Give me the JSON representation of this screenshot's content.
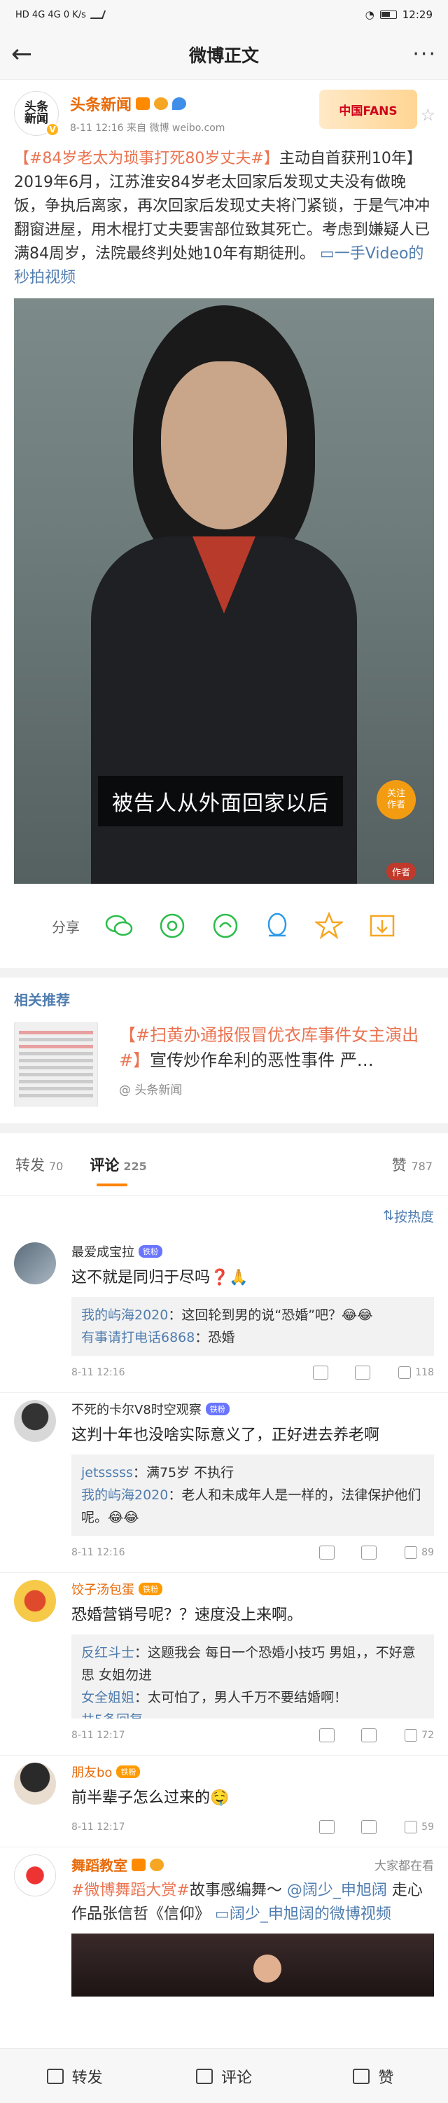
{
  "status": {
    "left": "HD 4G 4G 0 K/s",
    "time": "12:29"
  },
  "nav": {
    "title": "微博正文"
  },
  "author": {
    "name": "头条新闻",
    "avatar_text": "头条\n新闻",
    "meta": "8-11 12:16  来自 微博 weibo.com",
    "fans_badge": "中国FANS"
  },
  "post": {
    "topic": "【#84岁老太为琐事打死80岁丈夫#】",
    "body": "主动自首获刑10年】2019年6月，江苏淮安84岁老太回家后发现丈夫没有做晚饭，争执后离家，再次回家后发现丈夫将门紧锁，于是气冲冲翻窗进屋，用木棍打丈夫要害部位致其死亡。考虑到嫌疑人已满84周岁，法院最终判处她10年有期徒刑。",
    "link": "一手Video的秒拍视频"
  },
  "video": {
    "subtitle": "被告人从外面回家以后",
    "follow": "关注\n作者",
    "author_tag": "作者"
  },
  "share": {
    "label": "分享"
  },
  "recommend": {
    "title": "相关推荐",
    "topic": "【#扫黄办通报假冒优衣库事件女主演出#】",
    "text": "宣传炒作牟利的恶性事件 严…",
    "source": "@ 头条新闻"
  },
  "tabs": {
    "repost": "转发",
    "repost_count": "70",
    "comment": "评论",
    "comment_count": "225",
    "like": "赞",
    "like_count": "787",
    "sort": "按热度"
  },
  "comments": [
    {
      "name": "最爱成宝拉",
      "pill": "铁粉",
      "text": "这不就是同归于尽吗❓🙏",
      "replies": [
        {
          "name": "我的屿海2020",
          "text": "这回轮到男的说“恐婚”吧？😂😂"
        },
        {
          "name": "有事请打电话6868",
          "text": "恐婚"
        }
      ],
      "time": "8-11 12:16",
      "likes": "118"
    },
    {
      "name": "不死的卡尔V8时空观察",
      "pill": "铁粉",
      "text": "这判十年也没啥实际意义了，正好进去养老啊",
      "replies": [
        {
          "name": "jetsssss",
          "text": "满75岁 不执行"
        },
        {
          "name": "我的屿海2020",
          "text": "老人和未成年人是一样的，法律保护他们呢。😂😂"
        }
      ],
      "time": "8-11 12:16",
      "likes": "89"
    },
    {
      "name": "饺子汤包蛋",
      "pill": "铁粉",
      "text": "恐婚营销号呢？？速度没上来啊。",
      "replies": [
        {
          "name": "反红斗士",
          "text": "这题我会 每日一个恐婚小技巧 男姐，，不好意思 女姐勿进"
        },
        {
          "name": "女全姐姐",
          "text": "太可怕了，男人千万不要结婚啊！"
        },
        {
          "name": "共5条回复",
          "text": ""
        }
      ],
      "time": "8-11 12:17",
      "likes": "72"
    },
    {
      "name": "朋友bo",
      "pill": "铁粉",
      "text": "前半辈子怎么过来的🤤",
      "replies": [],
      "time": "8-11 12:17",
      "likes": "59"
    }
  ],
  "bottom_post": {
    "name": "舞蹈教室",
    "tag": "大家都在看",
    "topic": "#微博舞蹈大赏#",
    "text": "故事感编舞～",
    "mention": "@阔少_申旭阔",
    "text2": "走心作品张信哲《信仰》",
    "link": "阔少_申旭阔的微博视频"
  },
  "toolbar": {
    "repost": "转发",
    "comment": "评论",
    "like": "赞"
  }
}
